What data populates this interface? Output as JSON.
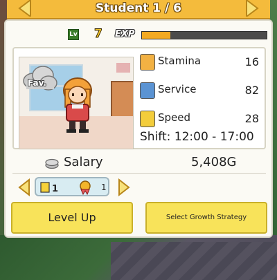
{
  "header": {
    "title": "Student 1 / 6"
  },
  "level": {
    "lv_icon_label": "Lv",
    "level_value": "7",
    "exp_label": "EXP",
    "exp_progress": 0.23
  },
  "portrait": {
    "fav_label": "Fav."
  },
  "stats": [
    {
      "icon": "stamina-icon",
      "label": "Stamina",
      "value": "16",
      "color": "#f2b143"
    },
    {
      "icon": "service-icon",
      "label": "Service",
      "value": "82",
      "color": "#5a93d3"
    },
    {
      "icon": "speed-icon",
      "label": "Speed",
      "value": "28",
      "color": "#f3cd3b"
    }
  ],
  "shift": "Shift: 12:00 - 17:00",
  "salary": {
    "label": "Salary",
    "value": "5,408G"
  },
  "badges": {
    "ticket_label": "1",
    "medal_count": "1"
  },
  "buttons": {
    "level_up": "Level Up",
    "growth": "Select Growth Strategy"
  },
  "colors": {
    "header": "#f4bb3c",
    "button": "#f8e35a",
    "exp_fill": "#f3a922"
  }
}
